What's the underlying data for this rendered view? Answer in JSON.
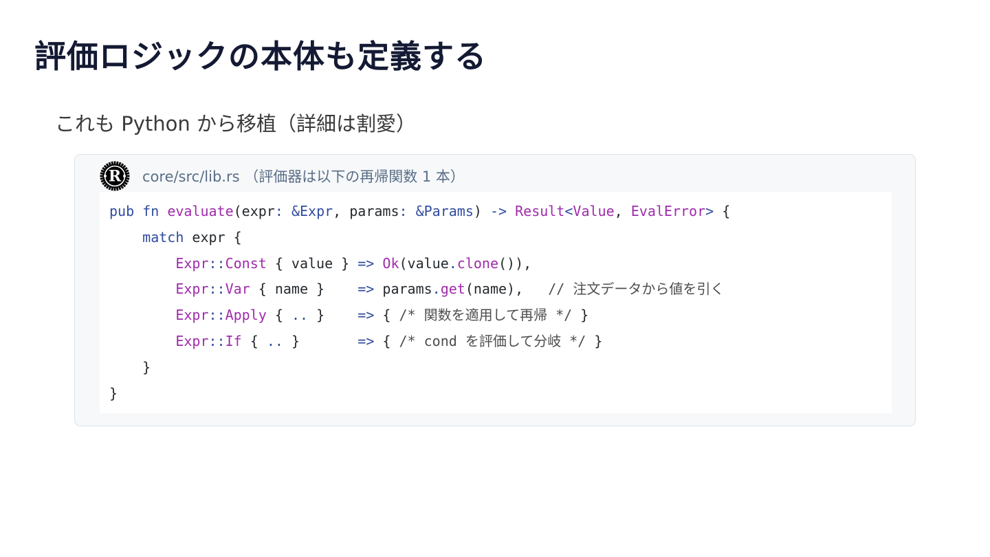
{
  "slide": {
    "title": "評価ロジックの本体も定義する",
    "subtitle": "これも Python から移植（詳細は割愛）"
  },
  "code_block": {
    "caption": "core/src/lib.rs （評価器は以下の再帰関数 1 本）",
    "logo_icon": "rust-logo-icon",
    "lines": [
      [
        {
          "t": "pub",
          "c": "kw"
        },
        {
          "t": " ",
          "c": "pl"
        },
        {
          "t": "fn",
          "c": "kw"
        },
        {
          "t": " ",
          "c": "pl"
        },
        {
          "t": "evaluate",
          "c": "fn"
        },
        {
          "t": "(expr",
          "c": "pl"
        },
        {
          "t": ":",
          "c": "op"
        },
        {
          "t": " ",
          "c": "pl"
        },
        {
          "t": "&Expr",
          "c": "op"
        },
        {
          "t": ", params",
          "c": "pl"
        },
        {
          "t": ":",
          "c": "op"
        },
        {
          "t": " ",
          "c": "pl"
        },
        {
          "t": "&Params",
          "c": "op"
        },
        {
          "t": ") ",
          "c": "pl"
        },
        {
          "t": "->",
          "c": "op"
        },
        {
          "t": " ",
          "c": "pl"
        },
        {
          "t": "Result",
          "c": "ty"
        },
        {
          "t": "<",
          "c": "op"
        },
        {
          "t": "Value",
          "c": "ty"
        },
        {
          "t": ", ",
          "c": "pl"
        },
        {
          "t": "EvalError",
          "c": "ty"
        },
        {
          "t": ">",
          "c": "op"
        },
        {
          "t": " {",
          "c": "pl"
        }
      ],
      [
        {
          "t": "    ",
          "c": "pl"
        },
        {
          "t": "match",
          "c": "kw"
        },
        {
          "t": " expr {",
          "c": "pl"
        }
      ],
      [
        {
          "t": "        ",
          "c": "pl"
        },
        {
          "t": "Expr",
          "c": "ty"
        },
        {
          "t": "::",
          "c": "op"
        },
        {
          "t": "Const",
          "c": "ty"
        },
        {
          "t": " { value } ",
          "c": "pl"
        },
        {
          "t": "=>",
          "c": "op"
        },
        {
          "t": " ",
          "c": "pl"
        },
        {
          "t": "Ok",
          "c": "ty"
        },
        {
          "t": "(value",
          "c": "pl"
        },
        {
          "t": ".",
          "c": "op"
        },
        {
          "t": "clone",
          "c": "fn"
        },
        {
          "t": "()),",
          "c": "pl"
        }
      ],
      [
        {
          "t": "        ",
          "c": "pl"
        },
        {
          "t": "Expr",
          "c": "ty"
        },
        {
          "t": "::",
          "c": "op"
        },
        {
          "t": "Var",
          "c": "ty"
        },
        {
          "t": " { name }    ",
          "c": "pl"
        },
        {
          "t": "=>",
          "c": "op"
        },
        {
          "t": " params",
          "c": "pl"
        },
        {
          "t": ".",
          "c": "op"
        },
        {
          "t": "get",
          "c": "fn"
        },
        {
          "t": "(name),   ",
          "c": "pl"
        },
        {
          "t": "// 注文データから値を引く",
          "c": "cm"
        }
      ],
      [
        {
          "t": "        ",
          "c": "pl"
        },
        {
          "t": "Expr",
          "c": "ty"
        },
        {
          "t": "::",
          "c": "op"
        },
        {
          "t": "Apply",
          "c": "ty"
        },
        {
          "t": " { ",
          "c": "pl"
        },
        {
          "t": "..",
          "c": "op"
        },
        {
          "t": " }    ",
          "c": "pl"
        },
        {
          "t": "=>",
          "c": "op"
        },
        {
          "t": " { ",
          "c": "pl"
        },
        {
          "t": "/* 関数を適用して再帰 */",
          "c": "cm"
        },
        {
          "t": " }",
          "c": "pl"
        }
      ],
      [
        {
          "t": "        ",
          "c": "pl"
        },
        {
          "t": "Expr",
          "c": "ty"
        },
        {
          "t": "::",
          "c": "op"
        },
        {
          "t": "If",
          "c": "ty"
        },
        {
          "t": " { ",
          "c": "pl"
        },
        {
          "t": "..",
          "c": "op"
        },
        {
          "t": " }       ",
          "c": "pl"
        },
        {
          "t": "=>",
          "c": "op"
        },
        {
          "t": " { ",
          "c": "pl"
        },
        {
          "t": "/* cond を評価して分岐 */",
          "c": "cm"
        },
        {
          "t": " }",
          "c": "pl"
        }
      ],
      [
        {
          "t": "    }",
          "c": "pl"
        }
      ],
      [
        {
          "t": "}",
          "c": "pl"
        }
      ]
    ]
  }
}
